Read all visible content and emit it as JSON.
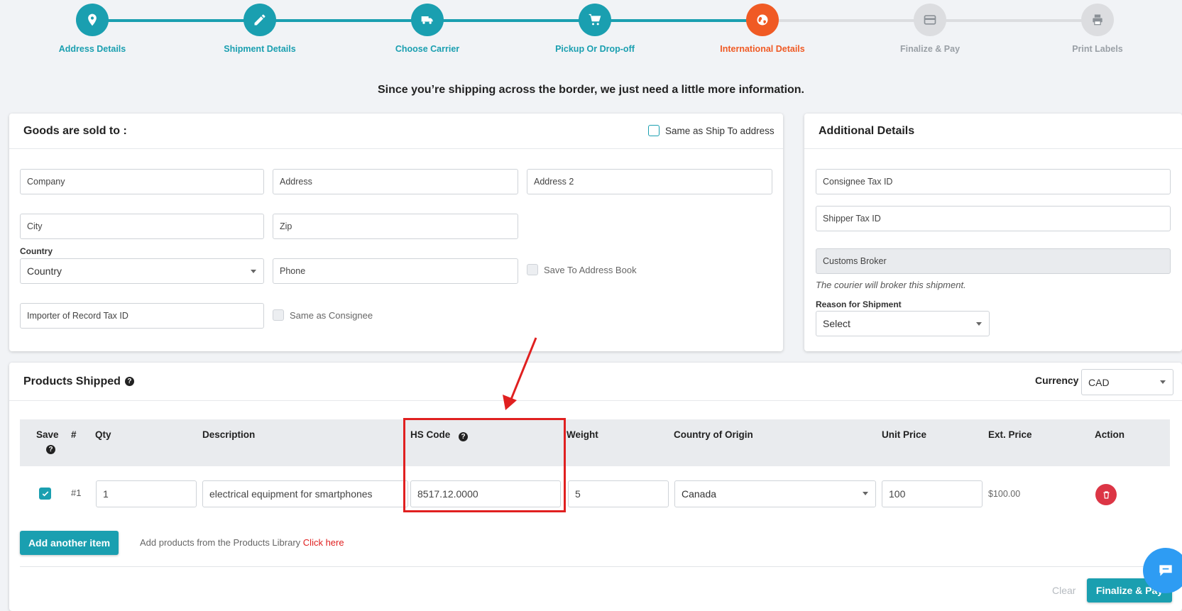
{
  "stepper": {
    "steps": [
      {
        "label": "Address Details",
        "icon": "map-pin-icon",
        "state": "done"
      },
      {
        "label": "Shipment Details",
        "icon": "pencil-icon",
        "state": "done"
      },
      {
        "label": "Choose Carrier",
        "icon": "truck-icon",
        "state": "done"
      },
      {
        "label": "Pickup Or Drop-off",
        "icon": "cart-icon",
        "state": "done"
      },
      {
        "label": "International Details",
        "icon": "globe-icon",
        "state": "active"
      },
      {
        "label": "Finalize & Pay",
        "icon": "credit-card-icon",
        "state": "todo"
      },
      {
        "label": "Print Labels",
        "icon": "printer-icon",
        "state": "todo"
      }
    ]
  },
  "intro": "Since you’re shipping across the border, we just need a little more information.",
  "sold_to": {
    "title": "Goods are sold to :",
    "same_as_ship_to": "Same as Ship To address",
    "company_placeholder": "Company",
    "address_placeholder": "Address",
    "address2_placeholder": "Address 2",
    "city_placeholder": "City",
    "zip_placeholder": "Zip",
    "country_label": "Country",
    "country_value": "Country",
    "phone_placeholder": "Phone",
    "save_to_address_book": "Save To Address Book",
    "importer_tax_placeholder": "Importer of Record Tax ID",
    "same_as_consignee": "Same as Consignee"
  },
  "additional": {
    "title": "Additional Details",
    "consignee_tax_placeholder": "Consignee Tax ID",
    "shipper_tax_placeholder": "Shipper Tax ID",
    "customs_broker_value": "Customs Broker",
    "broker_note": "The courier will broker this shipment.",
    "reason_label": "Reason for Shipment",
    "reason_value": "Select"
  },
  "products": {
    "title": "Products Shipped",
    "currency_label": "Currency",
    "currency_value": "CAD",
    "columns": {
      "save": "Save",
      "num": "#",
      "qty": "Qty",
      "description": "Description",
      "hs_code": "HS Code",
      "weight": "Weight",
      "country_of_origin": "Country of Origin",
      "unit_price": "Unit Price",
      "ext_price": "Ext. Price",
      "action": "Action"
    },
    "row": {
      "num": "#1",
      "qty": "1",
      "description": "electrical equipment for smartphones",
      "hs_code": "8517.12.0000",
      "weight": "5",
      "country": "Canada",
      "unit_price": "100",
      "ext_price": "$100.00"
    },
    "add_item_label": "Add another item",
    "library_text": "Add products from the Products Library",
    "library_link": "Click here",
    "clear_label": "Clear",
    "finalize_label": "Finalize & Pay"
  },
  "colors": {
    "brand": "#1a9fb0",
    "active": "#f05a24",
    "danger": "#dc3545",
    "highlight": "#e02020"
  }
}
